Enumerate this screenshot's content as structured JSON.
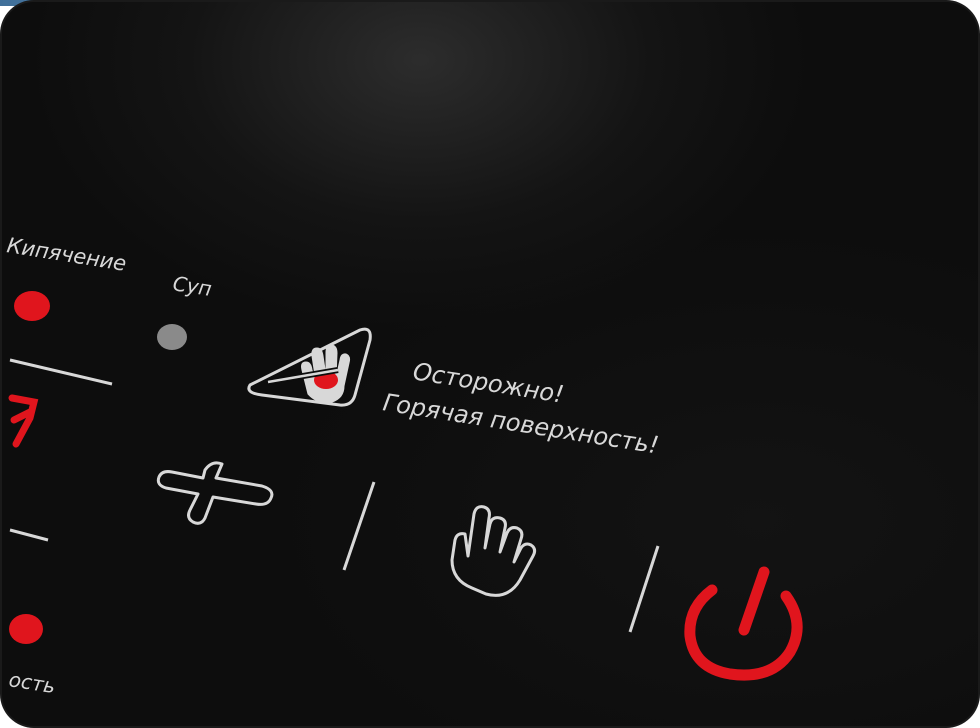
{
  "panel": {
    "label_boil": "Кипячение",
    "label_soup": "Суп",
    "label_power": "ость",
    "warning_line1": "Осторожно!",
    "warning_line2": "Горячая поверхность!"
  },
  "indicators": {
    "boil_led": "on",
    "soup_led": "off",
    "power_led": "on"
  },
  "icons": {
    "warning": "hot-surface-warning-icon",
    "plus": "plus-icon",
    "hand": "touch-hand-icon",
    "power": "power-icon"
  },
  "colors": {
    "surface": "#0d0d0d",
    "accent_red": "#e0151d",
    "label_gray": "#d8d8d8",
    "led_off": "#8a8a8a"
  }
}
